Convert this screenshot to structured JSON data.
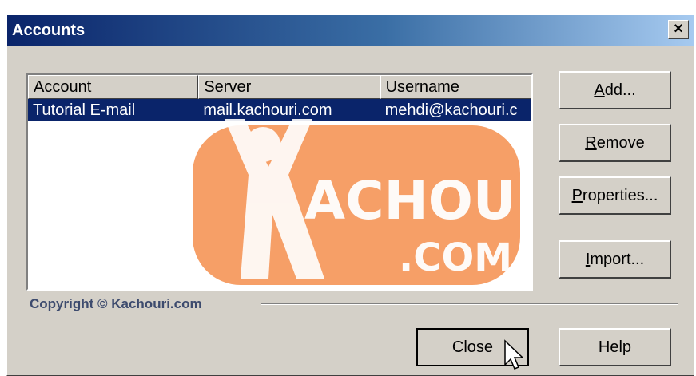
{
  "dialog": {
    "title": "Accounts",
    "close_glyph": "×"
  },
  "list": {
    "columns": [
      "Account",
      "Server",
      "Username"
    ],
    "rows": [
      {
        "account": "Tutorial E-mail",
        "server": "mail.kachouri.com",
        "username": "mehdi@kachouri.c",
        "selected": true
      }
    ]
  },
  "buttons": {
    "add": {
      "label": "Add...",
      "mnemonic": "A",
      "rest": "dd..."
    },
    "remove": {
      "label": "Remove",
      "mnemonic": "R",
      "rest": "emove"
    },
    "properties": {
      "label": "Properties...",
      "mnemonic": "P",
      "rest": "roperties..."
    },
    "import": {
      "label": "Import...",
      "mnemonic": "I",
      "rest": "mport..."
    },
    "close": {
      "label": "Close"
    },
    "help": {
      "label": "Help"
    }
  },
  "watermark": {
    "brand": "ACHOURI",
    "tld": ".COM"
  },
  "copyright": "Copyright © Kachouri.com",
  "colors": {
    "selection": "#0a246a",
    "dialog_bg": "#d4d0c8",
    "watermark": "#f27a2c"
  }
}
